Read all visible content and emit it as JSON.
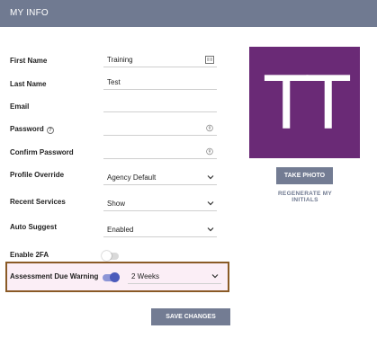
{
  "header": {
    "title": "MY INFO"
  },
  "form": {
    "first_name": {
      "label": "First Name",
      "value": "Training"
    },
    "last_name": {
      "label": "Last Name",
      "value": "Test"
    },
    "email": {
      "label": "Email",
      "value": ""
    },
    "password": {
      "label": "Password",
      "value": ""
    },
    "confirm_password": {
      "label": "Confirm Password",
      "value": ""
    },
    "profile_override": {
      "label": "Profile Override",
      "value": "Agency Default"
    },
    "recent_services": {
      "label": "Recent Services",
      "value": "Show"
    },
    "auto_suggest": {
      "label": "Auto Suggest",
      "value": "Enabled"
    },
    "enable_2fa": {
      "label": "Enable 2FA",
      "on": false
    },
    "assessment_due_warning": {
      "label": "Assessment Due Warning",
      "on": true,
      "value": "2 Weeks"
    }
  },
  "photo": {
    "initials": "TT",
    "background": "#6a2a76"
  },
  "actions": {
    "take_photo": "TAKE PHOTO",
    "regenerate_initials": "REGENERATE MY INITIALS",
    "save_changes": "SAVE CHANGES"
  },
  "colors": {
    "header": "#707a91",
    "button": "#737c93",
    "toggle_on": "#4b5bbb",
    "highlight_border": "#8a5a26"
  }
}
